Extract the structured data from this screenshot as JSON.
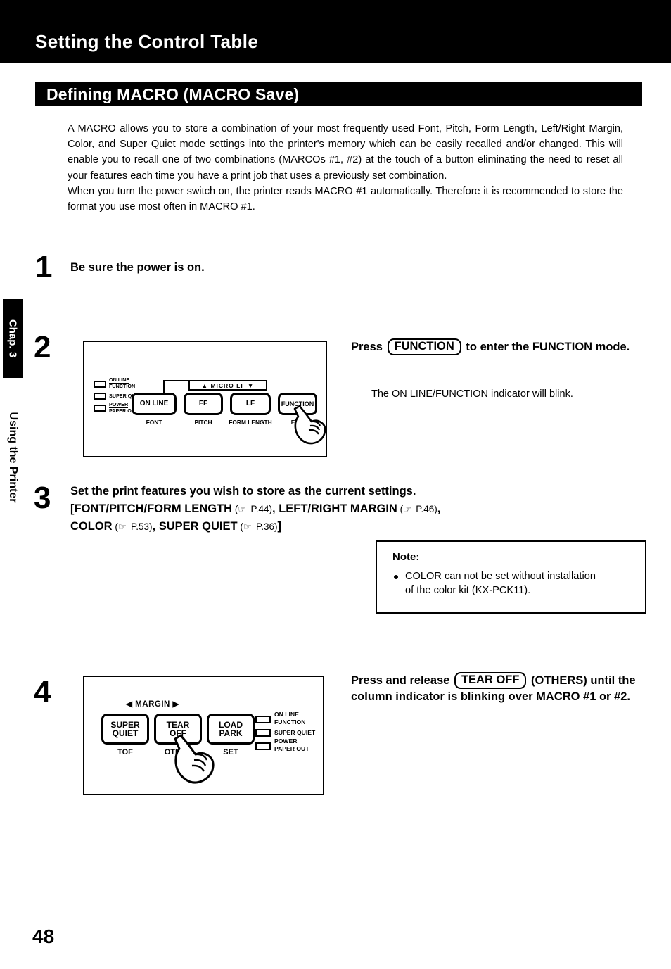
{
  "header": {
    "running_title": "Setting the Control Table",
    "section_title": "Defining MACRO (MACRO Save)"
  },
  "chapter_tab": {
    "chapter": "Chap. 3",
    "chapter_name": "Using the Printer"
  },
  "intro": {
    "para1": "A MACRO allows you to store a combination of your most frequently used Font, Pitch, Form Length, Left/Right Margin, Color, and Super Quiet mode settings into the printer's memory which can be easily recalled and/or changed. This will enable you to recall one of two combinations (MARCOs #1, #2) at the touch of a button eliminating the need to reset all your features each time you have a print job that uses a previously set combination.",
    "para2": "When you turn the power switch on, the printer reads MACRO #1 automatically. Therefore it is recommended to store the format you use most often in MACRO #1."
  },
  "steps": [
    {
      "number": "1",
      "title": "Be sure the power is on."
    },
    {
      "number": "2",
      "title_pre": "Press",
      "key": "FUNCTION",
      "title_post": "to enter the FUNCTION mode.",
      "note": "The ON LINE/FUNCTION indicator will blink."
    },
    {
      "number": "3",
      "line1": "Set the print features you wish to store as the current settings.",
      "line2_a": "[FONT/PITCH/FORM LENGTH",
      "ref1": "P.44",
      "line2_b": "LEFT/RIGHT MARGIN",
      "ref2": "P.46",
      "line3_a": "COLOR",
      "ref3": "P.53",
      "line3_b": "SUPER QUIET",
      "ref4": "P.36"
    },
    {
      "number": "4",
      "title_pre": "Press and release",
      "key": "TEAR OFF",
      "title_post": "(OTHERS) until the column indicator is blinking over MACRO #1 or #2."
    }
  ],
  "note_box": {
    "heading": "Note:",
    "bullet_line1": "COLOR can not be set without installation",
    "bullet_line2": "of the color kit (KX-PCK11)."
  },
  "panel_step2": {
    "micro_lf": "▲  MICRO LF  ▼",
    "keys": [
      {
        "top": "ON LINE",
        "bottom": "FONT"
      },
      {
        "top": "FF",
        "bottom": "PITCH"
      },
      {
        "top": "LF",
        "bottom": "FORM LENGTH"
      },
      {
        "top": "FUNCTION",
        "bottom": "EXIT"
      }
    ],
    "leds": [
      {
        "line1": "ON LINE",
        "line2": "FUNCTION"
      },
      {
        "line1": "SUPER QUIET",
        "line2": ""
      },
      {
        "line1": "POWER",
        "line2": "PAPER OUT"
      }
    ]
  },
  "panel_step4": {
    "margin_label": "◀  MARGIN  ▶",
    "keys": [
      {
        "top1": "SUPER",
        "top2": "QUIET",
        "bottom": "TOF"
      },
      {
        "top1": "TEAR",
        "top2": "OFF",
        "bottom": "OTHER"
      },
      {
        "top1": "LOAD",
        "top2": "PARK",
        "bottom": "SET"
      }
    ],
    "leds": [
      {
        "line1": "ON LINE",
        "line2": "FUNCTION"
      },
      {
        "line1": "SUPER QUIET",
        "line2": ""
      },
      {
        "line1": "POWER",
        "line2": "PAPER OUT"
      }
    ]
  },
  "footer": {
    "page_number": "48"
  },
  "icons": {
    "page_ref": "pointing-hand-icon"
  }
}
